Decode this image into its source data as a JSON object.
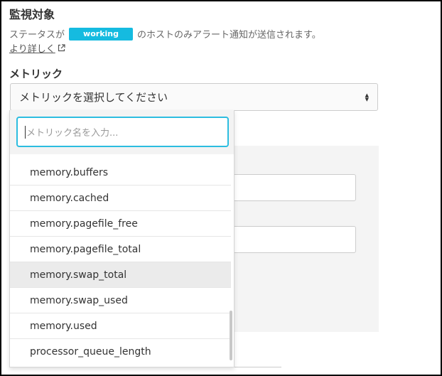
{
  "section": {
    "title": "監視対象",
    "desc_prefix": "ステータスが",
    "status_badge": "working",
    "desc_suffix": "のホストのみアラート通知が送信されます。",
    "more_link": "より詳しく",
    "accent_color": "#15bbe0"
  },
  "metric": {
    "label": "メトリック",
    "select_value": "メトリックを選択してください",
    "search_placeholder": "メトリック名を入力...",
    "options": [
      "memory.buffers",
      "memory.cached",
      "memory.pagefile_free",
      "memory.pagefile_total",
      "memory.swap_total",
      "memory.swap_used",
      "memory.used",
      "processor_queue_length"
    ],
    "highlighted": "memory.swap_total"
  },
  "icons": {
    "external_link": "external-link-icon",
    "select_caret": "sort-caret-icon"
  }
}
